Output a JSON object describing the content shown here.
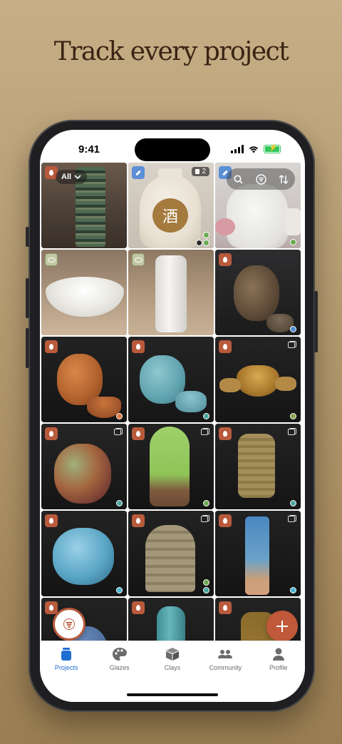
{
  "headline": "Track every project",
  "status": {
    "time": "9:41"
  },
  "filter": {
    "label": "All"
  },
  "photo_count": "2",
  "tabs": [
    {
      "label": "Projects",
      "icon": "jar-icon",
      "active": true
    },
    {
      "label": "Glazes",
      "icon": "palette-icon",
      "active": false
    },
    {
      "label": "Clays",
      "icon": "cube-icon",
      "active": false
    },
    {
      "label": "Community",
      "icon": "people-icon",
      "active": false
    },
    {
      "label": "Profile",
      "icon": "person-icon",
      "active": false
    }
  ],
  "colors": {
    "accent": "#c0583a",
    "tab_active": "#1f6fd1",
    "status_green": "#6aaa50",
    "status_teal": "#4ba7a0",
    "status_orange": "#e07a3c",
    "status_blue": "#4a8ed6"
  }
}
